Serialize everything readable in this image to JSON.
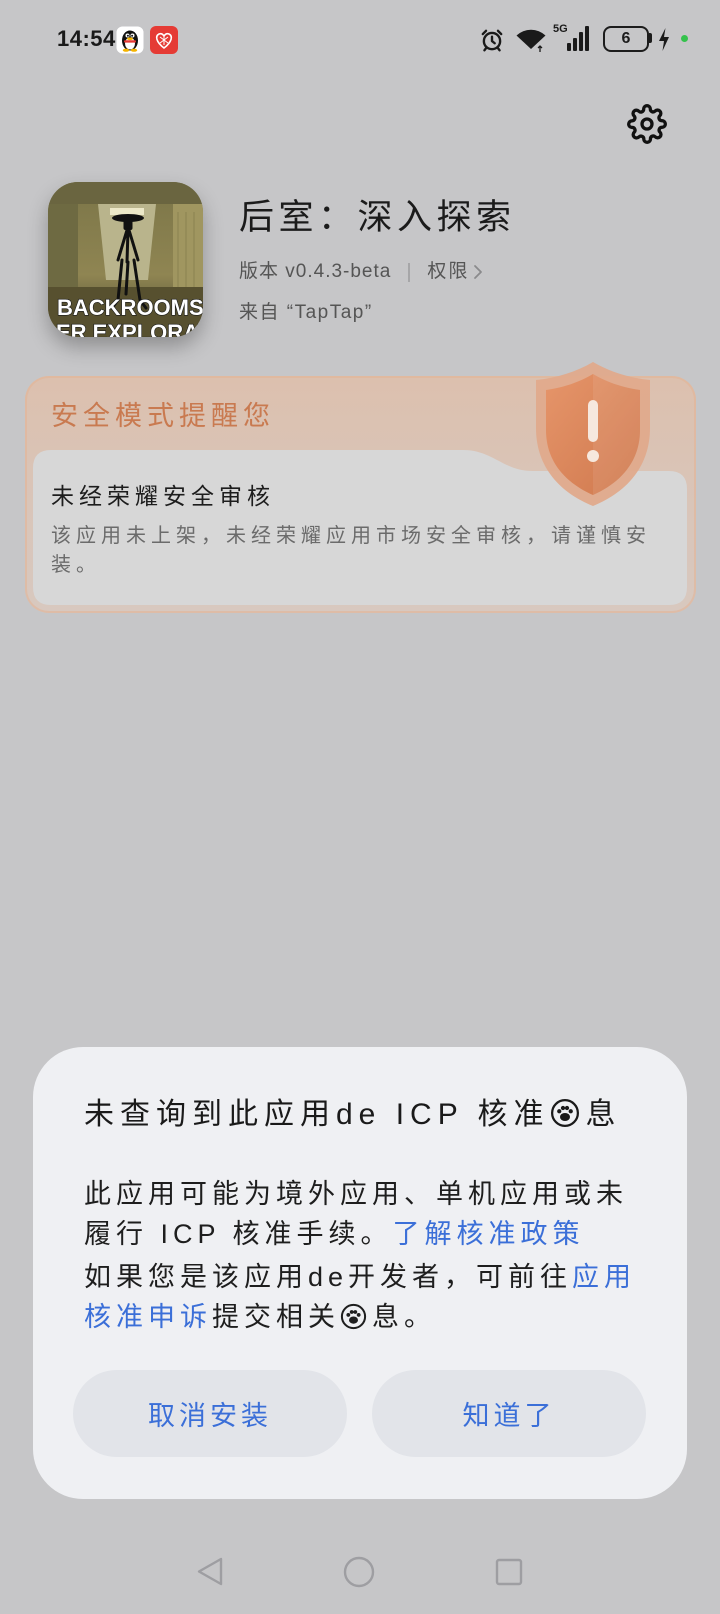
{
  "status_bar": {
    "time": "14:54",
    "network_type": "5G",
    "battery_level": "6",
    "icons": [
      "qq-icon",
      "red-app-icon",
      "alarm-icon",
      "wifi-icon",
      "signal-icon",
      "battery-icon",
      "charging-icon"
    ]
  },
  "header": {
    "settings_icon": "gear-icon"
  },
  "app": {
    "icon_text_line1": "BACKROOMS:",
    "icon_text_line2": "ER EXPLORAT",
    "title": "后室：深入探索",
    "version_label": "版本 v0.4.3-beta",
    "permissions_label": "权限",
    "source_label": "来自 “TapTap”"
  },
  "security_card": {
    "header": "安全模式提醒您",
    "title": "未经荣耀安全审核",
    "description": "该应用未上架，未经荣耀应用市场安全审核，请谨慎安装。",
    "icon": "shield-warning-icon"
  },
  "dialog": {
    "title_before_icon": "未查询到此应用de ICP 核准",
    "title_after_icon": "息",
    "paragraph1_text": "此应用可能为境外应用、单机应用或未履行 ICP 核准手续。",
    "paragraph1_link": "了解核准政策",
    "paragraph2_text": "如果您是该应用de开发者，可前往",
    "paragraph2_link": "应用核准申诉",
    "paragraph2_tail_before_icon": "提交相关",
    "paragraph2_tail_after_icon": "息。",
    "inline_icon": "paw-icon",
    "cancel_button": "取消安装",
    "confirm_button": "知道了"
  },
  "nav_bar": {
    "icons": [
      "back-icon",
      "home-icon",
      "recents-icon"
    ]
  },
  "colors": {
    "page_background": "#c6c6c8",
    "warning_orange": "#c97a50",
    "link_blue": "#3b6fd8",
    "dialog_background": "#eff0f3",
    "button_background": "#e2e4e9",
    "status_dot_green": "#34c24c"
  }
}
